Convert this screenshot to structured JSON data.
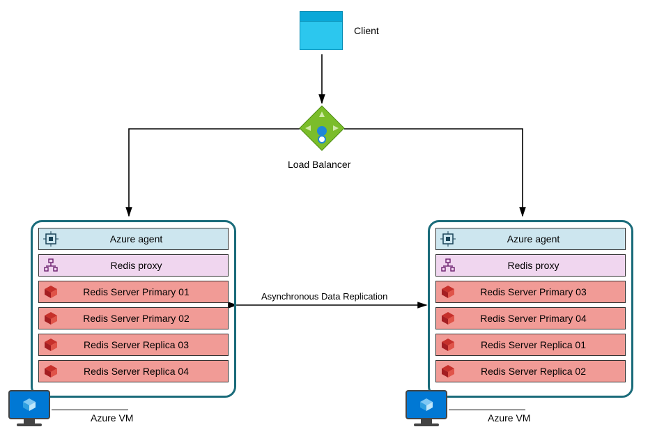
{
  "client_label": "Client",
  "load_balancer_label": "Load Balancer",
  "replication_label": "Asynchronous Data Replication",
  "vm_left": {
    "vm_label": "Azure VM",
    "agent": "Azure agent",
    "proxy": "Redis proxy",
    "servers": [
      "Redis Server Primary 01",
      "Redis Server Primary 02",
      "Redis Server Replica 03",
      "Redis Server Replica 04"
    ]
  },
  "vm_right": {
    "vm_label": "Azure VM",
    "agent": "Azure agent",
    "proxy": "Redis proxy",
    "servers": [
      "Redis Server Primary 03",
      "Redis Server Primary 04",
      "Redis Server Replica 01",
      "Redis Server Replica 02"
    ]
  }
}
